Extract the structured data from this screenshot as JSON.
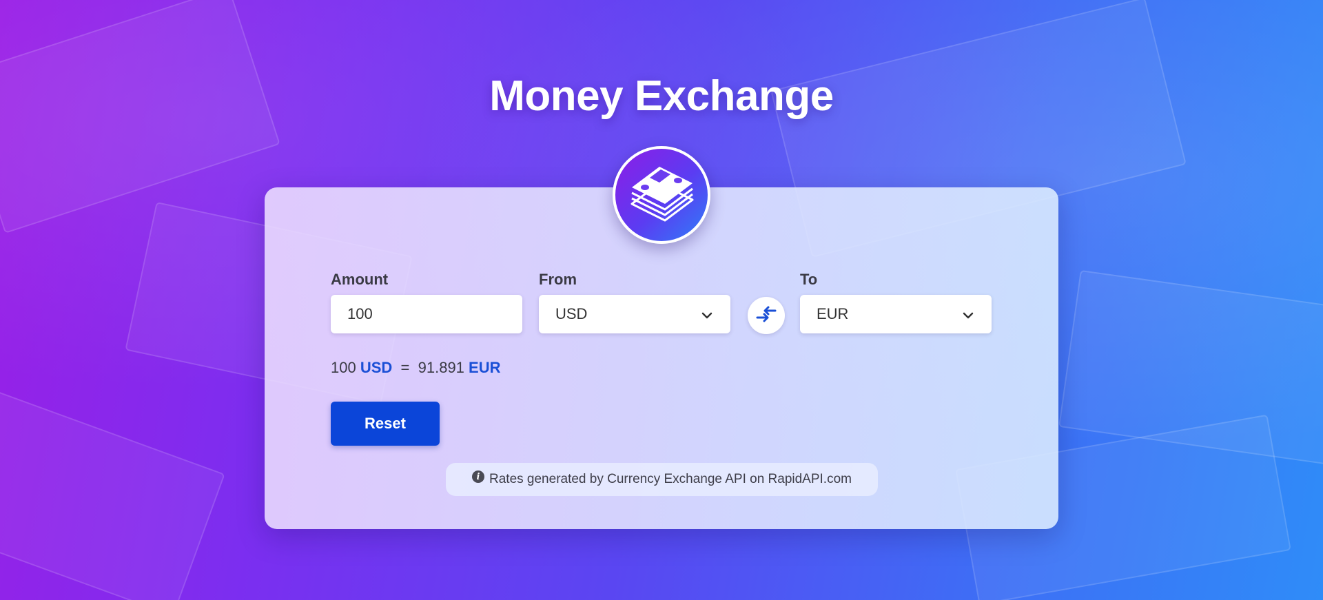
{
  "page": {
    "title": "Money Exchange"
  },
  "form": {
    "amount_label": "Amount",
    "amount_value": "100",
    "from_label": "From",
    "from_value": "USD",
    "to_label": "To",
    "to_value": "EUR"
  },
  "result": {
    "amount": "100",
    "from_currency": "USD",
    "equals": "=",
    "converted": "91.891",
    "to_currency": "EUR"
  },
  "actions": {
    "reset_label": "Reset"
  },
  "footer": {
    "note": "Rates generated by Currency Exchange API on RapidAPI.com",
    "info_icon": "i"
  },
  "colors": {
    "accent": "#0b45d9",
    "currency_text": "#1a4fd6"
  }
}
